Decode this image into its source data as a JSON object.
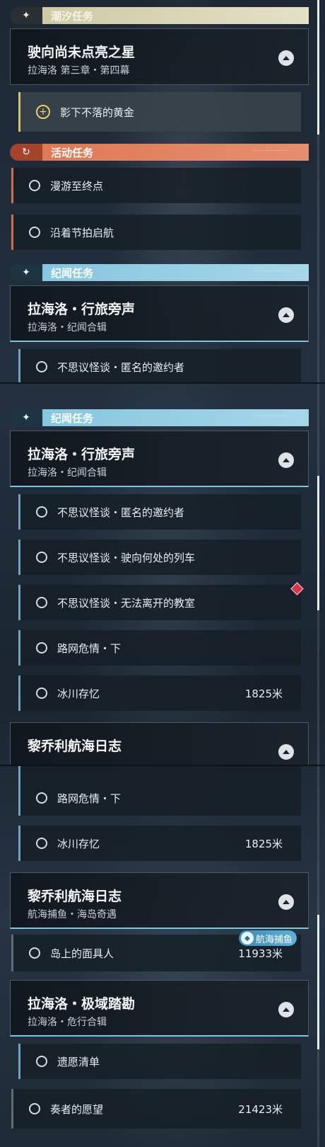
{
  "categories": {
    "tide": {
      "label": "潮汐任务",
      "icon": "sparkle-icon",
      "glyph": "✦"
    },
    "event": {
      "label": "活动任务",
      "icon": "refresh-icon",
      "glyph": "↻"
    },
    "story": {
      "label": "纪闻任务",
      "icon": "sparkle-icon",
      "glyph": "✦"
    }
  },
  "panel1": {
    "tide_group": {
      "title": "驶向尚未点亮之星",
      "subtitle": "拉海洛 第三章・第四幕"
    },
    "tide_active": {
      "name": "影下不落的黄金"
    },
    "event_rows": [
      {
        "name": "漫游至终点"
      },
      {
        "name": "沿着节拍启航"
      }
    ],
    "story_group": {
      "title": "拉海洛・行旅旁声",
      "subtitle": "拉海洛・纪闻合辑"
    },
    "story_peek": {
      "name": "不思议怪谈・匿名的邀约者"
    }
  },
  "panel2": {
    "story_group": {
      "title": "拉海洛・行旅旁声",
      "subtitle": "拉海洛・纪闻合辑"
    },
    "rows": [
      {
        "name": "不思议怪谈・匿名的邀约者",
        "dist": ""
      },
      {
        "name": "不思议怪谈・驶向何处的列车",
        "dist": ""
      },
      {
        "name": "不思议怪谈・无法离开的教室",
        "dist": ""
      },
      {
        "name": "路网危情・下",
        "dist": ""
      },
      {
        "name": "冰川存忆",
        "dist": "1825米"
      }
    ],
    "next_group": {
      "title": "黎乔利航海日志"
    }
  },
  "panel3": {
    "rows_top": [
      {
        "name": "路网危情・下",
        "dist": ""
      },
      {
        "name": "冰川存忆",
        "dist": "1825米"
      }
    ],
    "log_group": {
      "title": "黎乔利航海日志",
      "subtitle": "航海捕鱼・海岛奇遇"
    },
    "log_tag": "航海捕鱼",
    "log_row": {
      "name": "岛上的面具人",
      "dist": "11933米"
    },
    "polar_group": {
      "title": "拉海洛・极域踏勘",
      "subtitle": "拉海洛・危行合辑"
    },
    "polar_rows": [
      {
        "name": "遗愿清单",
        "dist": ""
      }
    ],
    "last_row": {
      "name": "奏者的愿望",
      "dist": "21423米"
    }
  },
  "colors": {
    "tide": "#cfc9a4",
    "event": "#e07955",
    "story": "#86c7df",
    "active_accent": "#e7cf6c"
  }
}
